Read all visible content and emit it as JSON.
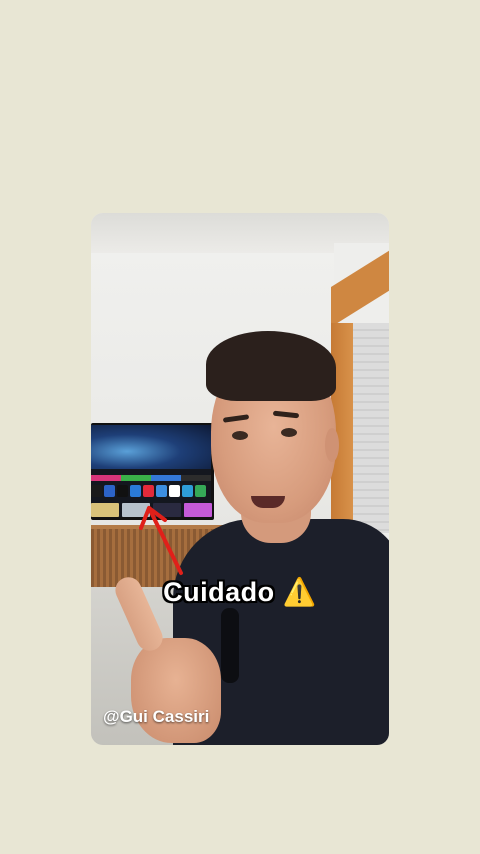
{
  "video": {
    "caption_text": "Cuidado",
    "caption_icon": "⚠️",
    "watermark": "@Gui Cassiri"
  },
  "colors": {
    "background": "#e8e6d4",
    "caption_text": "#ffffff",
    "arrow": "#e0201a",
    "warning_icon": "#f5c518"
  },
  "icons": {
    "annotation": "red-arrow-icon",
    "warning": "warning-icon"
  }
}
